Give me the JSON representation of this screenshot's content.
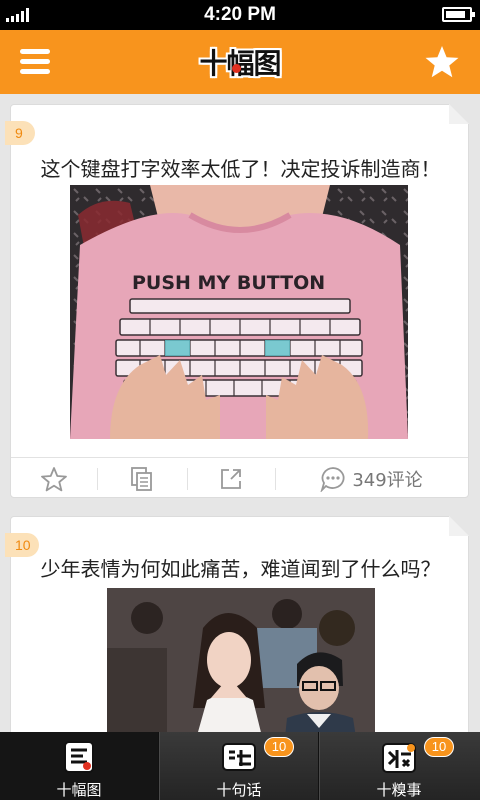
{
  "status_bar": {
    "time": "4:20 PM"
  },
  "header": {
    "logo_text": "十幅图",
    "menu_icon": "hamburger-menu-icon",
    "favorite_icon": "star-icon",
    "brand_color": "#f8941d"
  },
  "feed": {
    "items": [
      {
        "number": "9",
        "title": "这个键盘打字效率太低了！决定投诉制造商！",
        "image_text": "PUSH MY BUTTON",
        "actions": {
          "favorite_icon": "star-outline-icon",
          "copy_icon": "copy-icon",
          "share_icon": "share-icon",
          "comment_icon": "comment-bubble-icon",
          "comment_count": "349评论"
        }
      },
      {
        "number": "10",
        "title": "少年表情为何如此痛苦，难道闻到了什么吗？"
      }
    ]
  },
  "tab_bar": {
    "tabs": [
      {
        "label": "十幅图",
        "icon": "picture-tab-icon",
        "active": true
      },
      {
        "label": "十句话",
        "icon": "speech-tab-icon",
        "badge": "10"
      },
      {
        "label": "十糗事",
        "icon": "joke-tab-icon",
        "badge": "10"
      }
    ]
  }
}
